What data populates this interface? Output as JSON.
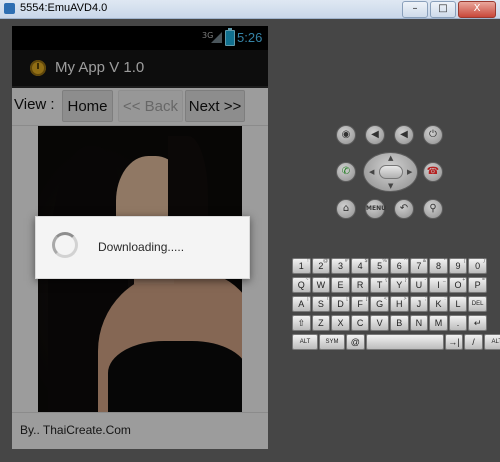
{
  "window": {
    "title": "5554:EmuAVD4.0",
    "controls": [
      "–",
      "□",
      "X"
    ]
  },
  "phone": {
    "status": {
      "network": "3G",
      "time": "5:26"
    },
    "app_title": "My App V 1.0",
    "view_label": "View :",
    "buttons": {
      "home": "Home",
      "back": "<< Back",
      "next": "Next >>"
    },
    "footer": "By.. ThaiCreate.Com",
    "dialog": {
      "message": "Downloading....."
    }
  },
  "hardware": {
    "buttons": [
      {
        "icon": "camera-icon",
        "glyph": "◉"
      },
      {
        "icon": "volume-down-icon",
        "glyph": "◀"
      },
      {
        "icon": "volume-up-icon",
        "glyph": "◀"
      },
      {
        "icon": "power-icon",
        "glyph": "⏻"
      },
      {
        "icon": "call-icon",
        "glyph": "✆"
      },
      {
        "icon": "end-call-icon",
        "glyph": "☎"
      },
      {
        "icon": "home-icon",
        "glyph": "⌂"
      },
      {
        "icon": "menu-icon",
        "glyph": "MENU"
      },
      {
        "icon": "back-icon",
        "glyph": "↶"
      },
      {
        "icon": "search-icon",
        "glyph": "⚲"
      }
    ]
  },
  "keyboard": {
    "rows": [
      [
        [
          "1",
          "!"
        ],
        [
          "2",
          "@"
        ],
        [
          "3",
          "#"
        ],
        [
          "4",
          "$"
        ],
        [
          "5",
          "%"
        ],
        [
          "6",
          "^"
        ],
        [
          "7",
          "&"
        ],
        [
          "8",
          "*"
        ],
        [
          "9",
          "("
        ],
        [
          "0",
          ")"
        ]
      ],
      [
        [
          "Q",
          "~"
        ],
        [
          "W",
          "\""
        ],
        [
          "E",
          "'"
        ],
        [
          "R",
          "`"
        ],
        [
          "T",
          "{"
        ],
        [
          "Y",
          "}"
        ],
        [
          "U",
          "-"
        ],
        [
          "I",
          "_"
        ],
        [
          "O",
          "+"
        ],
        [
          "P",
          "="
        ]
      ],
      [
        [
          "A",
          "|"
        ],
        [
          "S",
          "\\"
        ],
        [
          "D",
          "["
        ],
        [
          "F",
          "]"
        ],
        [
          "G",
          "<"
        ],
        [
          "H",
          ">"
        ],
        [
          "J",
          ";"
        ],
        [
          "K",
          ":"
        ],
        [
          "L",
          "\""
        ],
        [
          "DEL",
          ""
        ]
      ],
      [
        [
          "⇧",
          ""
        ],
        [
          "Z",
          ""
        ],
        [
          "X",
          ""
        ],
        [
          "C",
          ""
        ],
        [
          "V",
          ""
        ],
        [
          "B",
          ""
        ],
        [
          "N",
          ""
        ],
        [
          "M",
          ""
        ],
        [
          ".",
          ""
        ],
        [
          "↵",
          ""
        ]
      ],
      [
        [
          "ALT",
          ""
        ],
        [
          "SYM",
          ""
        ],
        [
          "@",
          ""
        ],
        [
          "",
          ""
        ],
        [
          "→|",
          ""
        ],
        [
          "/",
          ""
        ],
        [
          "ALT",
          ""
        ]
      ]
    ]
  }
}
